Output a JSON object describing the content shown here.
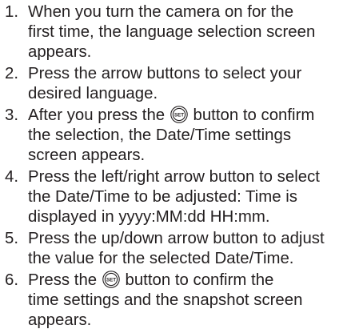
{
  "steps": [
    {
      "number": "1.",
      "lines": [
        "When you turn the camera on for the",
        "first time, the language selection screen",
        "appears."
      ]
    },
    {
      "number": "2.",
      "lines": [
        "Press the arrow buttons to select your",
        "desired language."
      ]
    },
    {
      "number": "3.",
      "line1_before_icon": "After you press the",
      "line1_after_icon": "button to confirm",
      "lines_rest": [
        "the selection, the Date/Time settings",
        "screen appears."
      ]
    },
    {
      "number": "4.",
      "lines": [
        "Press the left/right arrow button to select",
        "the Date/Time to be adjusted: Time is",
        "displayed in yyyy:MM:dd HH:mm."
      ]
    },
    {
      "number": "5.",
      "lines": [
        "Press the up/down arrow button to adjust",
        "the value for the selected Date/Time."
      ]
    },
    {
      "number": "6.",
      "line1_before_icon": "Press the",
      "line1_after_icon": "button to confirm the",
      "lines_rest": [
        "time settings and the snapshot screen",
        "appears."
      ]
    }
  ],
  "icons": {
    "set_button": "set-button-icon",
    "set_label": "SET"
  },
  "colors": {
    "text": "#231f20",
    "background": "#ffffff"
  }
}
